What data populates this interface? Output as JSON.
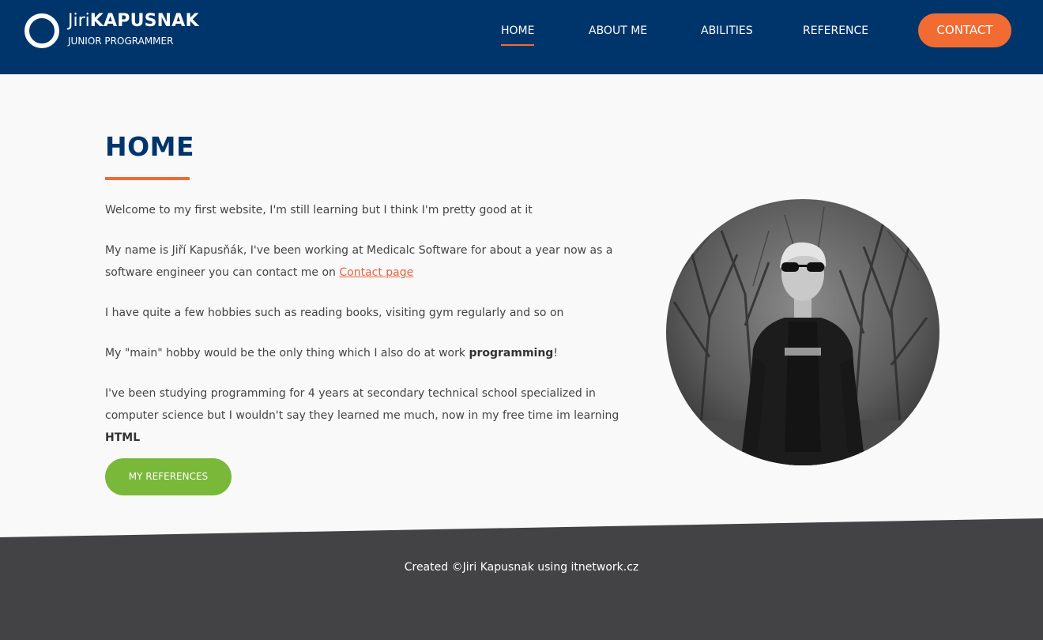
{
  "brand": {
    "first_name": "Jiri",
    "last_name": "KAPUSNAK",
    "subtitle": "JUNIOR PROGRAMMER"
  },
  "nav": {
    "items": [
      {
        "label": "HOME",
        "active": true
      },
      {
        "label": "ABOUT ME",
        "active": false
      },
      {
        "label": "ABILITIES",
        "active": false
      },
      {
        "label": "REFERENCE",
        "active": false
      }
    ],
    "contact_label": "CONTACT"
  },
  "main": {
    "title": "HOME",
    "p1": "Welcome to my first website, I'm still learning but I think I'm pretty good at it",
    "p2_text": "My name is Jiří Kapusňák, I've been working at Medicalc Software for about a year now as a software engineer you can contact me on ",
    "p2_link": "Contact page",
    "p3": "I have quite a few hobbies such as reading books, visiting gym regularly and so on",
    "p4_text": "My \"main\" hobby would be the only thing which I also do at work ",
    "p4_bold": "programming",
    "p4_end": "!",
    "p5_text": "I've been studying programming for 4 years at secondary technical school specialized in computer science but I wouldn't say they learned me much, now in my free time im learning ",
    "p5_bold": "HTML",
    "button_label": "MY REFERENCES"
  },
  "footer": {
    "text": "Created ©Jiri Kapusnak using itnetwork.cz"
  },
  "colors": {
    "header_bg": "#00356b",
    "accent": "#f26b32",
    "button_green": "#7ab83a",
    "footer_bg": "#434345",
    "page_bg": "#f9f9f9"
  }
}
